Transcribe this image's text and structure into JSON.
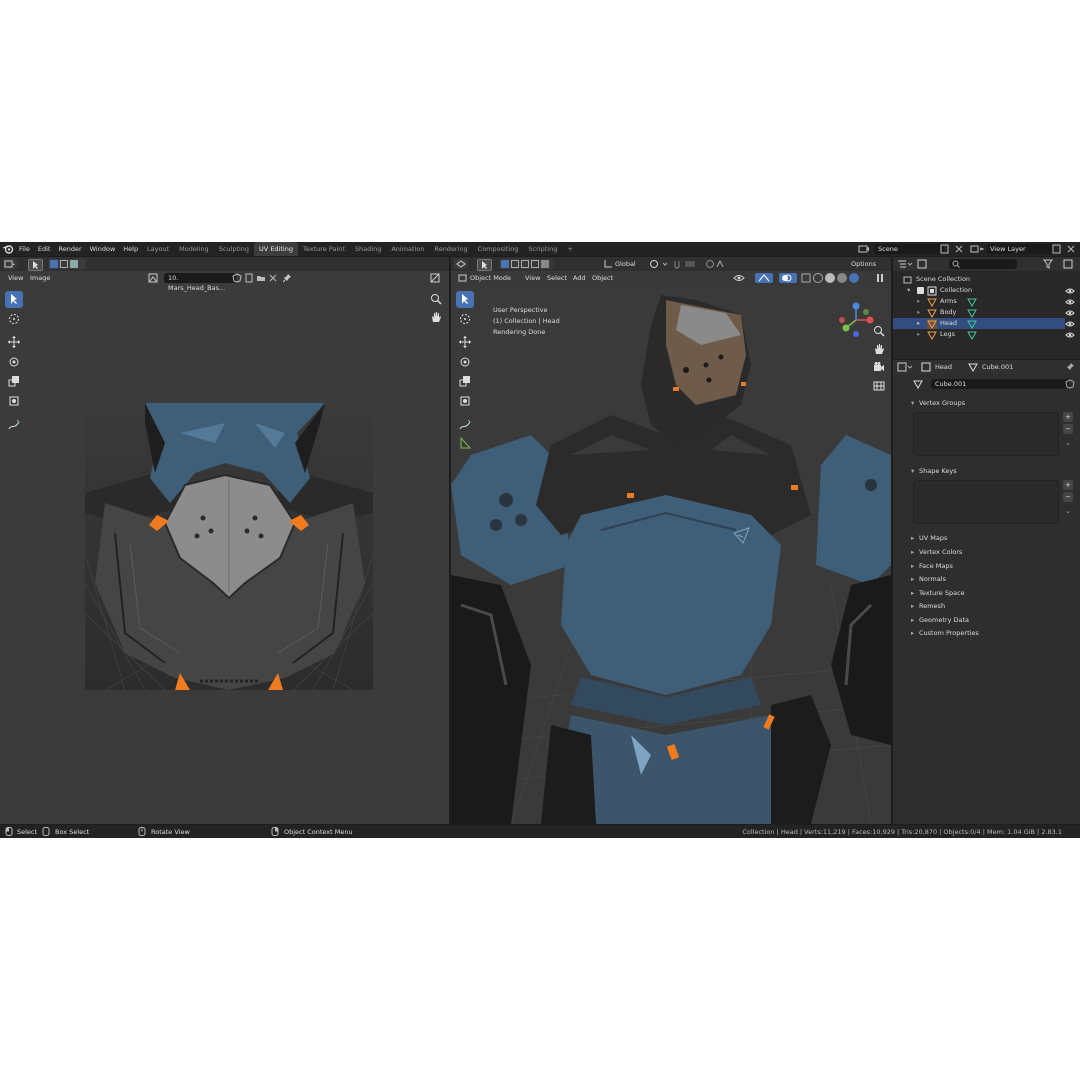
{
  "menu": [
    "File",
    "Edit",
    "Render",
    "Window",
    "Help"
  ],
  "workspaces": [
    "Layout",
    "Modeling",
    "Sculpting",
    "UV Editing",
    "Texture Paint",
    "Shading",
    "Animation",
    "Rendering",
    "Compositing",
    "Scripting"
  ],
  "active_workspace": "UV Editing",
  "scene": {
    "label": "Scene",
    "view_layer": "View Layer"
  },
  "uv_editor": {
    "menu": [
      "View",
      "Image"
    ],
    "image_name": "10. Mars_Head_Bas..."
  },
  "viewport": {
    "mode": "Object Mode",
    "menu": [
      "View",
      "Select",
      "Add",
      "Object"
    ],
    "transform": "Global",
    "options": "Options",
    "overlay_lines": [
      "User Perspective",
      "(1) Collection | Head",
      "Rendering Done"
    ]
  },
  "outliner": {
    "root": "Scene Collection",
    "collection": "Collection",
    "items": [
      "Arms",
      "Body",
      "Head",
      "Legs"
    ]
  },
  "properties": {
    "object": "Head",
    "mesh": "Cube.001",
    "mesh_field": "Cube.001",
    "panels_open": [
      "Vertex Groups",
      "Shape Keys"
    ],
    "panels_closed": [
      "UV Maps",
      "Vertex Colors",
      "Face Maps",
      "Normals",
      "Texture Space",
      "Remesh",
      "Geometry Data",
      "Custom Properties"
    ]
  },
  "status": {
    "select": "Select",
    "box_select": "Box Select",
    "rotate": "Rotate View",
    "context": "Object Context Menu",
    "info": "Collection | Head | Verts:11,219 | Faces:10,929 | Tris:20,870 | Objects:0/4 | Mem: 1.04 GiB | 2.83.1"
  },
  "colors": {
    "accent": "#4772b3",
    "armor_blue": "#3f5f78",
    "orange": "#f07a1e",
    "mesh_green": "#3fc7a0"
  }
}
